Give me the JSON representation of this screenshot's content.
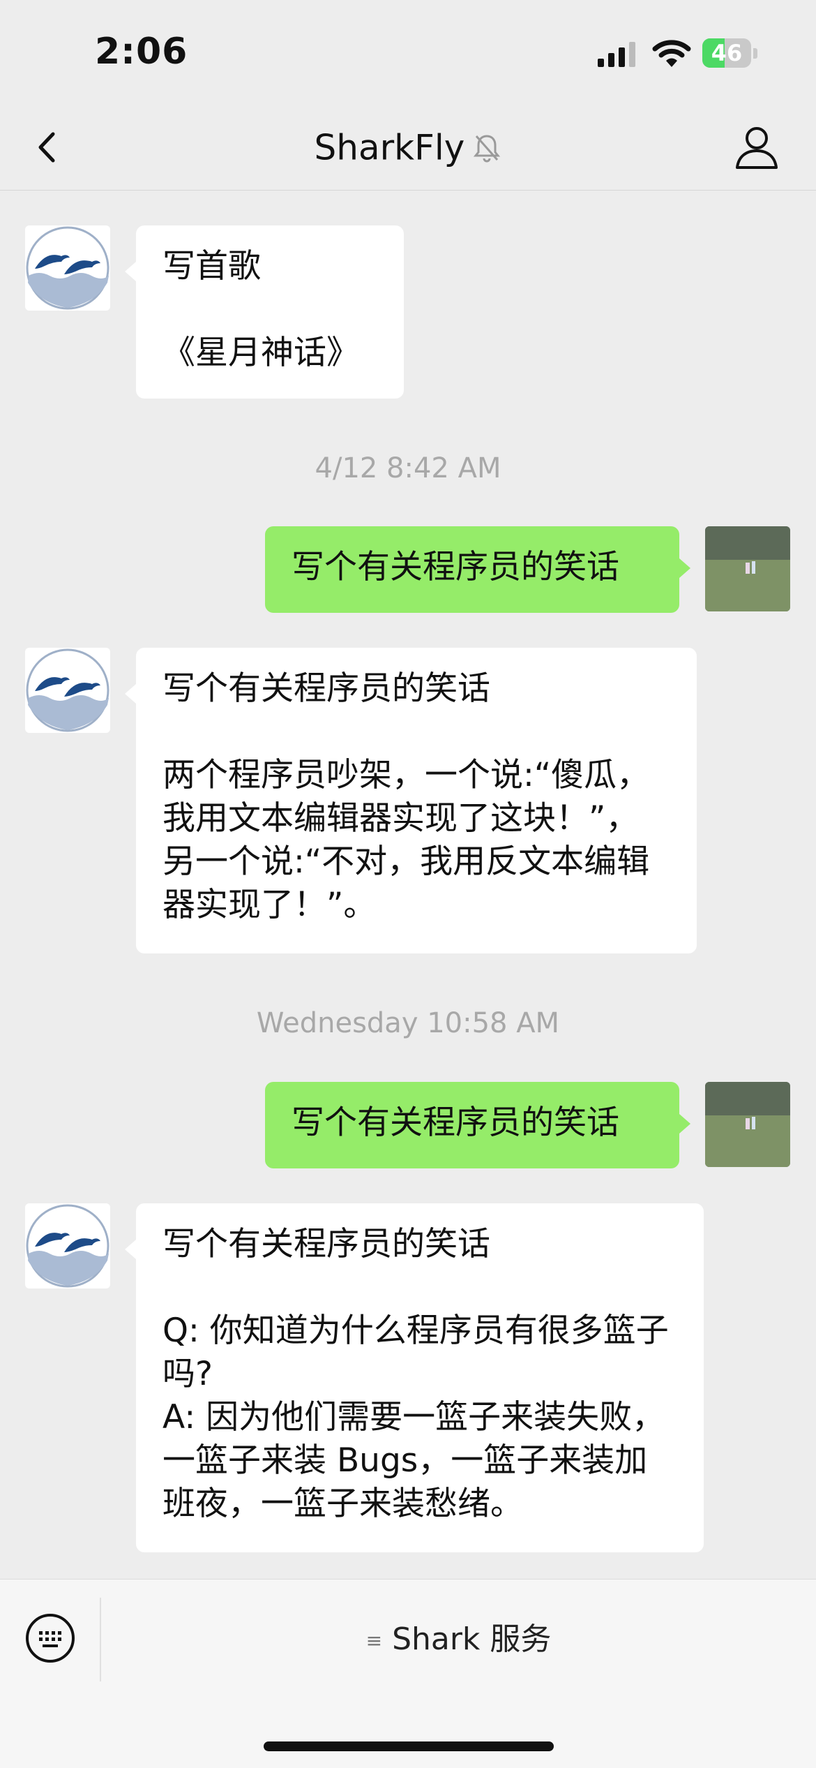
{
  "status_bar": {
    "time": "2:06",
    "battery": "46",
    "battery_level": 0.46
  },
  "header": {
    "title": "SharkFly",
    "back_icon": "chevron-left-icon",
    "mute_icon": "bell-slash-icon",
    "profile_icon": "person-icon"
  },
  "messages": [
    {
      "type": "incoming",
      "text": "写首歌\n\n《星月神话》"
    },
    {
      "type": "timestamp",
      "text": "4/12 8:42 AM"
    },
    {
      "type": "outgoing",
      "text": "写个有关程序员的笑话"
    },
    {
      "type": "incoming",
      "text": "写个有关程序员的笑话\n\n两个程序员吵架，一个说:“傻瓜，我用文本编辑器实现了这块！”，另一个说:“不对，我用反文本编辑器实现了！”。"
    },
    {
      "type": "timestamp",
      "text": "Wednesday 10:58 AM"
    },
    {
      "type": "outgoing",
      "text": "写个有关程序员的笑话"
    },
    {
      "type": "incoming",
      "text": "写个有关程序员的笑话\n\nQ: 你知道为什么程序员有很多篮子吗?\nA: 因为他们需要一篮子来装失败，一篮子来装 Bugs，一篮子来装加班夜，一篮子来装愁绪。"
    }
  ],
  "bottom_bar": {
    "service_label": "Shark 服务",
    "service_icon": "≡",
    "keyboard_icon": "keyboard-icon"
  },
  "colors": {
    "background": "#ededed",
    "outgoing_bubble": "#95ec69",
    "incoming_bubble": "#ffffff",
    "timestamp": "#a8a8a8"
  }
}
